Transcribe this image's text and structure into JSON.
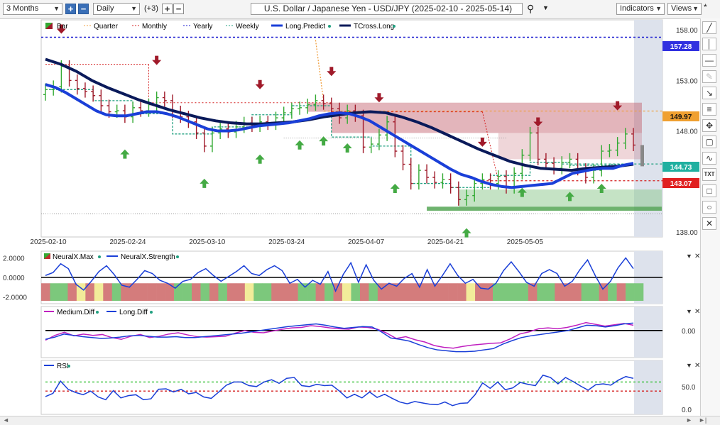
{
  "toolbar": {
    "range": "3 Months",
    "interval": "Daily",
    "extra": "(+3)",
    "title": "U.S. Dollar / Japanese Yen - USD/JPY (2025-02-10 - 2025-05-14)",
    "indicators": "Indicators",
    "views": "Views",
    "star": "*"
  },
  "colors": {
    "bar_up": "#33aa33",
    "bar_down": "#a01a2a",
    "quarter": "#f0a040",
    "monthly": "#d42020",
    "yearly": "#1a1ad0",
    "weekly": "#20a080",
    "long_predict": "#1a3fd8",
    "tcross_long": "#0a1a5a",
    "neural_max": "#c03030",
    "neural_strength": "#1a3fd8",
    "medium_diff": "#c020c0",
    "long_diff": "#1a3fd8",
    "rsi": "#1a3fd8",
    "badge_yearly": "#3030e0",
    "badge_quarter": "#f0a030",
    "badge_predict": "#20b0a0",
    "badge_monthly": "#e02020"
  },
  "chart_data": [
    {
      "type": "candlestick",
      "title": "U.S. Dollar / Japanese Yen - USD/JPY (2025-02-10 - 2025-05-14)",
      "legend": [
        "Bar",
        "Quarter",
        "Monthly",
        "Yearly",
        "Weekly",
        "Long.Predict",
        "TCross.Long"
      ],
      "x_ticks": [
        "2025-02-10",
        "2025-02-24",
        "2025-03-10",
        "2025-03-24",
        "2025-04-07",
        "2025-04-21",
        "2025-05-05"
      ],
      "y_ticks": [
        138.0,
        143.0,
        148.0,
        153.0,
        158.0
      ],
      "ylim": [
        137.5,
        159
      ],
      "price_labels": {
        "yearly": "157.28",
        "quarter": "149.97",
        "predict": "144.73",
        "monthly": "143.07"
      },
      "close": [
        152.1,
        152.4,
        154.4,
        153.0,
        152.2,
        151.9,
        151.5,
        150.5,
        149.9,
        150.0,
        149.4,
        150.3,
        150.0,
        150.6,
        151.3,
        151.0,
        149.9,
        149.4,
        148.9,
        147.8,
        146.5,
        147.8,
        148.2,
        147.9,
        148.4,
        148.8,
        148.5,
        148.9,
        148.7,
        149.3,
        149.8,
        150.2,
        150.3,
        150.6,
        151.0,
        150.7,
        150.2,
        149.3,
        150.0,
        149.5,
        146.4,
        146.7,
        147.6,
        148.9,
        146.0,
        144.7,
        142.8,
        144.1,
        143.4,
        142.9,
        143.2,
        142.4,
        141.2,
        141.6,
        142.8,
        143.2,
        142.8,
        143.5,
        142.4,
        143.8,
        145.6,
        147.8,
        145.2,
        144.8,
        144.3,
        144.9,
        145.2,
        144.2,
        143.4,
        144.1,
        146.0,
        146.1,
        146.8,
        147.7,
        146.6
      ],
      "long_predict": [
        152.6,
        152.3,
        151.8,
        151.2,
        150.6,
        150.0,
        149.6,
        149.5,
        149.5,
        149.7,
        149.9,
        149.9,
        149.7,
        149.4,
        149.0,
        148.6,
        148.2,
        148.0,
        148.0,
        148.1,
        148.3,
        148.5,
        148.6,
        148.7,
        148.8,
        149.0,
        149.2,
        149.5,
        149.7,
        149.8,
        149.7,
        149.4,
        149.0,
        148.4,
        147.8,
        147.2,
        146.6,
        146.0,
        145.4,
        144.8,
        144.2,
        143.7,
        143.4,
        143.0,
        142.7,
        142.5,
        142.4,
        142.5,
        142.6,
        142.7,
        142.8,
        143.3,
        143.8,
        144.0,
        144.2,
        144.3,
        144.3,
        144.6,
        144.8
      ],
      "tcross_long": [
        155.1,
        154.6,
        153.9,
        153.0,
        152.3,
        151.7,
        151.1,
        150.6,
        150.1,
        149.7,
        149.3,
        149.0,
        148.8,
        148.7,
        148.7,
        148.8,
        148.9,
        149.1,
        149.4,
        149.6,
        149.8,
        149.9,
        149.8,
        149.4,
        148.9,
        148.3,
        147.6,
        146.9,
        146.2,
        145.6,
        145.0,
        144.6,
        144.3,
        144.2,
        144.1,
        144.3,
        144.4,
        144.5,
        144.7
      ]
    },
    {
      "type": "bar",
      "legend": [
        "NeuralX.Max",
        "NeuralX.Strength"
      ],
      "y_ticks": [
        2.0,
        0.0,
        -2.0
      ],
      "ylim": [
        -2.4,
        2.4
      ],
      "neural_strength": [
        0.2,
        0.5,
        1.4,
        0.9,
        -0.7,
        -1.3,
        -0.4,
        0.6,
        1.2,
        0.3,
        -0.8,
        -1.0,
        -0.2,
        0.7,
        0.4,
        -0.3,
        -0.6,
        -1.1,
        -0.4,
        -0.2,
        0.5,
        0.9,
        0.2,
        -0.4,
        0.1,
        0.6,
        1.2,
        0.4,
        0.2,
        0.8,
        1.2,
        0.7,
        -0.6,
        -0.2,
        -1.0,
        -0.3,
        -0.7,
        0.6,
        -1.4,
        0.3,
        1.5,
        -0.5,
        1.3,
        -0.3,
        -1.2,
        -0.6,
        -0.9,
        -0.1,
        0.4,
        -1.0,
        0.8,
        -0.9,
        0.2,
        1.4,
        0.2,
        -0.6,
        -0.2,
        -1.1,
        -1.2,
        -0.6,
        0.7,
        1.6,
        0.6,
        -0.5,
        -0.9,
        0.4,
        0.8,
        0.4,
        -0.9,
        -0.4,
        0.8,
        1.8,
        0.2,
        -1.2,
        -0.4,
        1.0,
        2.0,
        0.9
      ],
      "neural_bands": "RGGRYRYRGRRRRRRGGRGRGRRYGGRRRGGRGRYGRGRRRRRRRRRRYRRGGGGRGGRRRGGRGRGG"
    },
    {
      "type": "line",
      "legend": [
        "Medium.Diff",
        "Long.Diff"
      ],
      "y_ticks": [
        0.0
      ],
      "ylim": [
        -5.5,
        3.2
      ],
      "medium_diff": [
        -2.2,
        -1.1,
        -0.4,
        -1.2,
        -0.8,
        -1.1,
        -0.9,
        -1.6,
        -2.0,
        -1.3,
        -0.9,
        -1.6,
        -1.3,
        -0.8,
        -0.5,
        -1.0,
        -1.4,
        -1.5,
        -1.4,
        -1.3,
        -0.6,
        0.0,
        -0.4,
        -0.5,
        -0.1,
        0.3,
        0.6,
        0.7,
        1.1,
        0.9,
        0.6,
        0.4,
        0.3,
        0.8,
        0.7,
        0.3,
        -0.6,
        -1.8,
        -1.4,
        -2.1,
        -2.6,
        -3.4,
        -3.8,
        -4.0,
        -3.6,
        -3.3,
        -3.1,
        -2.9,
        -2.8,
        -1.9,
        -0.8,
        -0.3,
        0.4,
        0.6,
        0.4,
        0.7,
        1.2,
        1.8,
        1.4,
        1.0,
        1.3,
        1.6,
        1.2
      ],
      "long_diff": [
        -2.0,
        -1.5,
        -0.8,
        -1.1,
        -1.4,
        -1.6,
        -1.8,
        -1.7,
        -1.5,
        -1.2,
        -1.1,
        -1.3,
        -1.5,
        -1.5,
        -1.4,
        -1.6,
        -1.6,
        -1.4,
        -1.2,
        -1.0,
        -0.8,
        -0.6,
        -0.3,
        0.0,
        0.3,
        0.6,
        0.9,
        1.1,
        1.3,
        1.5,
        1.2,
        0.8,
        0.5,
        0.7,
        0.9,
        0.8,
        -0.3,
        -1.7,
        -2.0,
        -2.4,
        -3.2,
        -3.9,
        -4.4,
        -4.6,
        -4.8,
        -4.8,
        -4.7,
        -4.4,
        -4.1,
        -3.1,
        -2.3,
        -1.6,
        -1.2,
        -0.9,
        -0.6,
        -0.3,
        0.0,
        0.6,
        1.2,
        1.1,
        0.8,
        1.1,
        1.5,
        1.7
      ]
    },
    {
      "type": "line",
      "legend": [
        "RSI"
      ],
      "y_ticks": [
        50.0,
        0.0
      ],
      "ylim": [
        -5,
        95
      ],
      "rsi": [
        28,
        35,
        62,
        44,
        37,
        32,
        40,
        27,
        21,
        41,
        25,
        30,
        32,
        21,
        23,
        44,
        45,
        38,
        44,
        34,
        37,
        27,
        24,
        38,
        53,
        60,
        60,
        52,
        50,
        60,
        65,
        57,
        68,
        70,
        52,
        50,
        55,
        52,
        53,
        40,
        25,
        33,
        25,
        38,
        26,
        33,
        24,
        16,
        12,
        17,
        14,
        11,
        10,
        16,
        8,
        13,
        14,
        32,
        58,
        46,
        60,
        43,
        47,
        59,
        55,
        52,
        75,
        70,
        56,
        70,
        61,
        51,
        42,
        54,
        56,
        53,
        64,
        72,
        68
      ]
    }
  ],
  "panel_labels": {
    "bar": "Bar",
    "quarter": "Quarter",
    "monthly": "Monthly",
    "yearly": "Yearly",
    "weekly": "Weekly",
    "long_predict": "Long.Predict",
    "tcross_long": "TCross.Long",
    "neural_max": "NeuralX.Max",
    "neural_strength": "NeuralX.Strength",
    "medium_diff": "Medium.Diff",
    "long_diff": "Long.Diff",
    "rsi": "RSI"
  },
  "sidebar_tools": [
    "line-tool-icon",
    "segment-tool-icon",
    "vertical-line-icon",
    "horizontal-line-icon",
    "pencil-tool-icon",
    "pitchfork-icon",
    "crosshair-icon",
    "comment-icon",
    "wave-icon",
    "text-tool-icon",
    "rectangle-tool-icon",
    "ellipse-tool-icon",
    "delete-tool-icon"
  ]
}
